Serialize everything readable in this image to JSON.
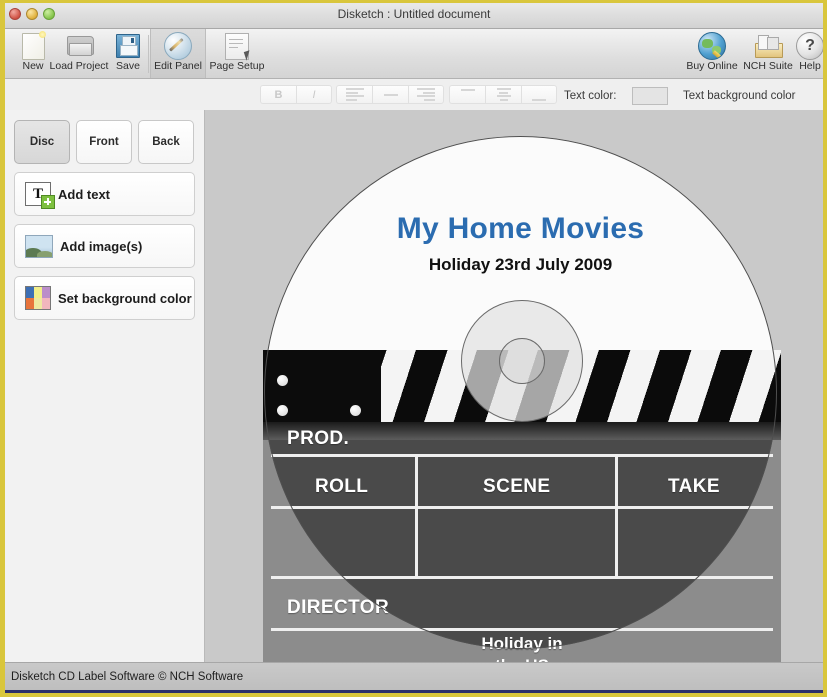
{
  "window": {
    "title": "Disketch : Untitled document",
    "traffic_lights": [
      "close",
      "minimize",
      "maximize"
    ]
  },
  "toolbar": {
    "items": [
      {
        "label": "New",
        "icon": "new-document-icon"
      },
      {
        "label": "Load Project",
        "icon": "folder-open-icon"
      },
      {
        "label": "Save",
        "icon": "floppy-disk-icon"
      },
      {
        "label": "Edit Panel",
        "icon": "pencil-circle-icon"
      },
      {
        "label": "Page Setup",
        "icon": "page-setup-icon"
      }
    ],
    "right_items": [
      {
        "label": "Buy Online",
        "icon": "globe-key-icon"
      },
      {
        "label": "NCH Suite",
        "icon": "suite-box-icon"
      },
      {
        "label": "Help",
        "icon": "question-circle-icon"
      }
    ]
  },
  "formatbar": {
    "bold_label": "B",
    "italic_label": "I",
    "text_color_label": "Text color:",
    "text_color_value": "#e4e4e4",
    "text_background_color_label": "Text background color",
    "align_icons": [
      "align-left-icon",
      "align-center-rule-icon",
      "align-right-icon"
    ],
    "spacing_icons": [
      "line-top-icon",
      "line-spacing-icon",
      "line-bottom-icon"
    ]
  },
  "sidebar": {
    "tabs": [
      {
        "label": "Disc",
        "selected": true
      },
      {
        "label": "Front",
        "selected": false
      },
      {
        "label": "Back",
        "selected": false
      }
    ],
    "buttons": [
      {
        "label": "Add text",
        "icon": "add-text-icon"
      },
      {
        "label": "Add image(s)",
        "icon": "add-image-icon"
      },
      {
        "label": "Set background color",
        "icon": "color-swatch-icon"
      }
    ]
  },
  "canvas": {
    "disc": {
      "title": "My Home Movies",
      "title_color": "#2b6cb0",
      "subtitle": "Holiday 23rd July 2009",
      "subtitle_color": "#111111"
    },
    "clapperboard": {
      "prod_label": "PROD.",
      "roll_label": "ROLL",
      "scene_label": "SCENE",
      "take_label": "TAKE",
      "director_label": "DIRECTOR",
      "scene_value": "Holiday in\nthe US",
      "scene_value_line1": "Holiday in",
      "scene_value_line2": "the US"
    }
  },
  "statusbar": {
    "text": "Disketch CD Label Software © NCH Software"
  }
}
